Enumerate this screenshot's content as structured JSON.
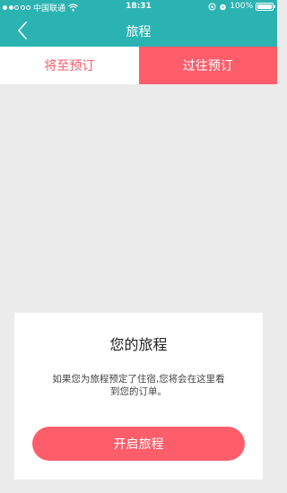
{
  "status_bar": {
    "carrier": "中国联通",
    "time": "18:31",
    "battery": "100%",
    "battery_level": 1.0,
    "signal_bars_filled": 2,
    "signal_bars_total": 5
  },
  "navbar": {
    "title": "旅程",
    "back_icon": "chevron-left-icon"
  },
  "tabs": [
    {
      "label": "将至预订",
      "active": false
    },
    {
      "label": "过往预订",
      "active": true
    }
  ],
  "empty_card": {
    "title": "您的旅程",
    "description": "如果您为旅程预定了住宿,您将会在这里看到您的订单。",
    "button_label": "开启旅程"
  },
  "colors": {
    "header": "#2bb3b2",
    "accent": "#fd5e6a",
    "background": "#ebebeb"
  }
}
